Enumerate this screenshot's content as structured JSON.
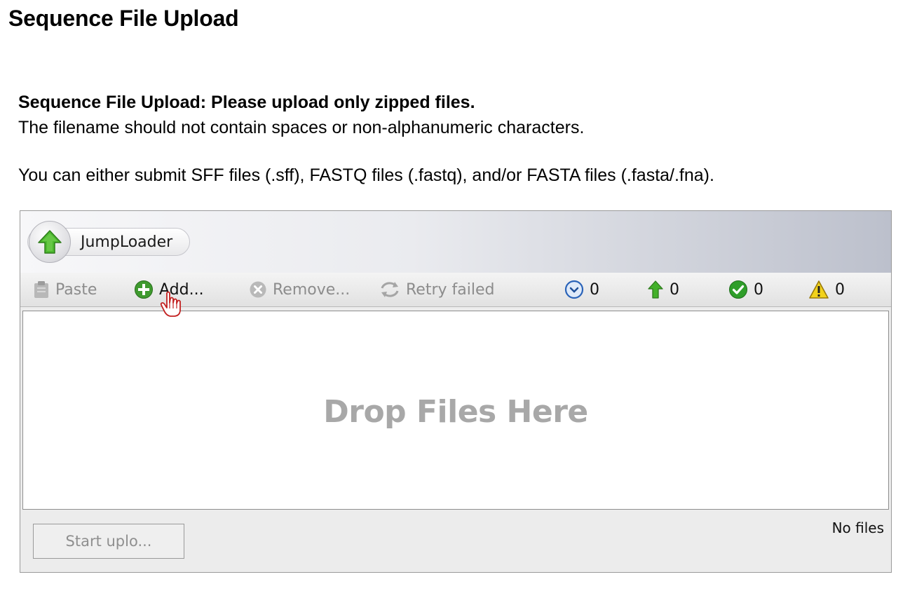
{
  "page": {
    "title": "Sequence File Upload"
  },
  "intro": {
    "heading": "Sequence File Upload: Please upload only zipped files.",
    "filename_note": "The filename should not contain spaces or non-alphanumeric characters.",
    "formats_note": "You can either submit SFF files (.sff), FASTQ files (.fastq), and/or FASTA files (.fasta/.fna)."
  },
  "uploader": {
    "brand": "JumpLoader",
    "toolbar": {
      "paste_label": "Paste",
      "add_label": "Add...",
      "remove_label": "Remove...",
      "retry_label": "Retry failed",
      "pending_count": "0",
      "uploading_count": "0",
      "finished_count": "0",
      "failed_count": "0"
    },
    "drop_text": "Drop Files Here",
    "start_label": "Start uplo...",
    "status_text": "No files"
  },
  "icons": {
    "brand": "up-arrow-icon",
    "paste": "clipboard-icon",
    "add": "plus-circle-icon",
    "remove": "x-circle-icon",
    "retry": "retry-icon",
    "pending": "clock-icon",
    "uploading": "up-arrow-icon",
    "finished": "check-circle-icon",
    "failed": "warning-icon",
    "cursor": "hand-cursor-icon"
  },
  "colors": {
    "add_green": "#3f9a2f",
    "check_green": "#2f9e2a",
    "arrow_green": "#43b02a",
    "warning_yellow": "#f2d21b",
    "clock_blue": "#2a63b8",
    "drop_text_gray": "#a8a8a8"
  }
}
